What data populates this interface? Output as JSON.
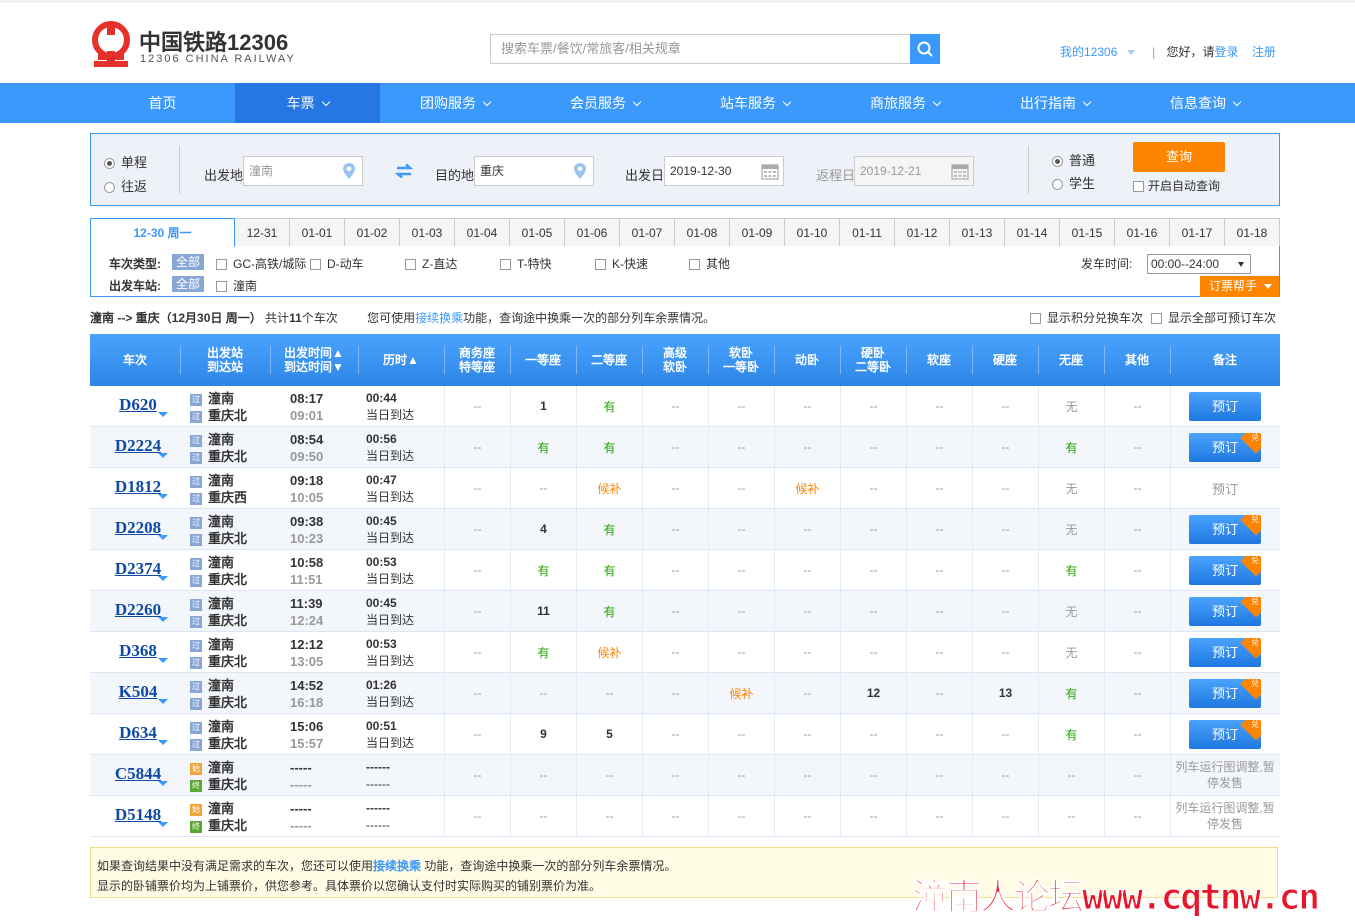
{
  "header": {
    "logo_cn": "中国铁路12306",
    "logo_en": "12306 CHINA RAILWAY",
    "search_placeholder": "搜索车票/餐饮/常旅客/相关规章",
    "my12306": "我的12306",
    "greeting": "您好，请",
    "login": "登录",
    "register": "注册"
  },
  "nav": [
    "首页",
    "车票",
    "团购服务",
    "会员服务",
    "站车服务",
    "商旅服务",
    "出行指南",
    "信息查询"
  ],
  "query": {
    "trip_one_way": "单程",
    "trip_round": "往返",
    "from_label": "出发地",
    "from_value": "潼南",
    "to_label": "目的地",
    "to_value": "重庆",
    "depart_label": "出发日",
    "depart_value": "2019-12-30",
    "return_label": "返程日",
    "return_value": "2019-12-21",
    "type_normal": "普通",
    "type_student": "学生",
    "query_btn": "查询",
    "auto_query": "开启自动查询"
  },
  "date_tabs": [
    "12-30 周一",
    "12-31",
    "01-01",
    "01-02",
    "01-03",
    "01-04",
    "01-05",
    "01-06",
    "01-07",
    "01-08",
    "01-09",
    "01-10",
    "01-11",
    "01-12",
    "01-13",
    "01-14",
    "01-15",
    "01-16",
    "01-17",
    "01-18"
  ],
  "filter": {
    "type_label": "车次类型:",
    "all": "全部",
    "types": [
      "GC-高铁/城际",
      "D-动车",
      "Z-直达",
      "T-特快",
      "K-快速",
      "其他"
    ],
    "station_label": "出发车站:",
    "stations": [
      "潼南"
    ],
    "time_label": "发车时间:",
    "time_value": "00:00--24:00",
    "help": "订票帮手"
  },
  "summary": {
    "route": "潼南 --> 重庆（12月30日  周一）",
    "count_pre": "共计",
    "count": "11",
    "count_post": "个车次",
    "tip_pre": "您可使用",
    "tip_link": "接续换乘",
    "tip_post": "功能，查询途中换乘一次的部分列车余票情况。",
    "opt_points": "显示积分兑换车次",
    "opt_all": "显示全部可预订车次"
  },
  "columns": [
    {
      "l1": "车次",
      "l2": ""
    },
    {
      "l1": "出发站",
      "l2": "到达站"
    },
    {
      "l1": "出发时间▲",
      "l2": "到达时间▼"
    },
    {
      "l1": "历时▲",
      "l2": ""
    },
    {
      "l1": "商务座",
      "l2": "特等座"
    },
    {
      "l1": "一等座",
      "l2": ""
    },
    {
      "l1": "二等座",
      "l2": ""
    },
    {
      "l1": "高级",
      "l2": "软卧"
    },
    {
      "l1": "软卧",
      "l2": "一等卧"
    },
    {
      "l1": "动卧",
      "l2": ""
    },
    {
      "l1": "硬卧",
      "l2": "二等卧"
    },
    {
      "l1": "软座",
      "l2": ""
    },
    {
      "l1": "硬座",
      "l2": ""
    },
    {
      "l1": "无座",
      "l2": ""
    },
    {
      "l1": "其他",
      "l2": ""
    },
    {
      "l1": "备注",
      "l2": ""
    }
  ],
  "station_icons": {
    "pass": "过",
    "start": "始",
    "end": "终"
  },
  "book_label": "预订",
  "dui_label": "兑",
  "trains": [
    {
      "no": "D620",
      "from": "潼南",
      "to": "重庆北",
      "dep": "08:17",
      "arr": "09:01",
      "dur": "00:44",
      "day": "当日到达",
      "seats": [
        "--",
        "1",
        "有",
        "--",
        "--",
        "--",
        "--",
        "--",
        "--",
        "无",
        "--"
      ],
      "book": "active",
      "dui": false
    },
    {
      "no": "D2224",
      "from": "潼南",
      "to": "重庆北",
      "dep": "08:54",
      "arr": "09:50",
      "dur": "00:56",
      "day": "当日到达",
      "seats": [
        "--",
        "有",
        "有",
        "--",
        "--",
        "--",
        "--",
        "--",
        "--",
        "有",
        "--"
      ],
      "book": "active",
      "dui": true
    },
    {
      "no": "D1812",
      "from": "潼南",
      "to": "重庆西",
      "dep": "09:18",
      "arr": "10:05",
      "dur": "00:47",
      "day": "当日到达",
      "seats": [
        "--",
        "--",
        "候补",
        "--",
        "--",
        "候补",
        "--",
        "--",
        "--",
        "无",
        "--"
      ],
      "book": "grey",
      "dui": false
    },
    {
      "no": "D2208",
      "from": "潼南",
      "to": "重庆北",
      "dep": "09:38",
      "arr": "10:23",
      "dur": "00:45",
      "day": "当日到达",
      "seats": [
        "--",
        "4",
        "有",
        "--",
        "--",
        "--",
        "--",
        "--",
        "--",
        "无",
        "--"
      ],
      "book": "active",
      "dui": true
    },
    {
      "no": "D2374",
      "from": "潼南",
      "to": "重庆北",
      "dep": "10:58",
      "arr": "11:51",
      "dur": "00:53",
      "day": "当日到达",
      "seats": [
        "--",
        "有",
        "有",
        "--",
        "--",
        "--",
        "--",
        "--",
        "--",
        "有",
        "--"
      ],
      "book": "active",
      "dui": true
    },
    {
      "no": "D2260",
      "from": "潼南",
      "to": "重庆北",
      "dep": "11:39",
      "arr": "12:24",
      "dur": "00:45",
      "day": "当日到达",
      "seats": [
        "--",
        "11",
        "有",
        "--",
        "--",
        "--",
        "--",
        "--",
        "--",
        "无",
        "--"
      ],
      "book": "active",
      "dui": true
    },
    {
      "no": "D368",
      "from": "潼南",
      "to": "重庆北",
      "dep": "12:12",
      "arr": "13:05",
      "dur": "00:53",
      "day": "当日到达",
      "seats": [
        "--",
        "有",
        "候补",
        "--",
        "--",
        "--",
        "--",
        "--",
        "--",
        "无",
        "--"
      ],
      "book": "active",
      "dui": true
    },
    {
      "no": "K504",
      "from": "潼南",
      "to": "重庆北",
      "dep": "14:52",
      "arr": "16:18",
      "dur": "01:26",
      "day": "当日到达",
      "seats": [
        "--",
        "--",
        "--",
        "--",
        "候补",
        "--",
        "12",
        "--",
        "13",
        "有",
        "--"
      ],
      "book": "active",
      "dui": true
    },
    {
      "no": "D634",
      "from": "潼南",
      "to": "重庆北",
      "dep": "15:06",
      "arr": "15:57",
      "dur": "00:51",
      "day": "当日到达",
      "seats": [
        "--",
        "9",
        "5",
        "--",
        "--",
        "--",
        "--",
        "--",
        "--",
        "有",
        "--"
      ],
      "book": "active",
      "dui": true
    },
    {
      "no": "C5844",
      "from": "潼南",
      "to": "重庆北",
      "dep": "-----",
      "arr": "-----",
      "dur": "------",
      "day": "------",
      "seats": [
        "--",
        "--",
        "--",
        "--",
        "--",
        "--",
        "--",
        "--",
        "--",
        "--",
        "--"
      ],
      "book": "note",
      "note": "列车运行图调整,暂停发售",
      "dui": false,
      "terminal": true
    },
    {
      "no": "D5148",
      "from": "潼南",
      "to": "重庆北",
      "dep": "-----",
      "arr": "-----",
      "dur": "------",
      "day": "------",
      "seats": [
        "--",
        "--",
        "--",
        "--",
        "--",
        "--",
        "--",
        "--",
        "--",
        "--",
        "--"
      ],
      "book": "note",
      "note": "列车运行图调整,暂停发售",
      "dui": false,
      "terminal": true
    }
  ],
  "tip": {
    "line1_pre": "如果查询结果中没有满足需求的车次，您还可以使用",
    "line1_link": "接续换乘",
    "line1_post": " 功能，查询途中换乘一次的部分列车余票情况。",
    "line2": "显示的卧铺票价均为上铺票价，供您参考。具体票价以您确认支付时实际购买的铺别票价为准。"
  },
  "watermark": "潼南人论坛www.cqtnw.cn",
  "colors": {
    "brand_blue": "#3b99fc",
    "orange": "#ff8400",
    "green_available": "#26a306",
    "logo_red": "#e6302b"
  }
}
